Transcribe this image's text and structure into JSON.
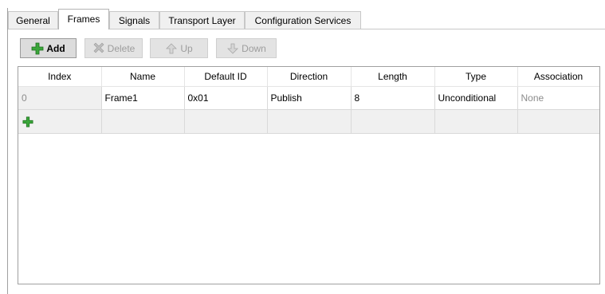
{
  "tabs": [
    {
      "label": "General"
    },
    {
      "label": "Frames",
      "active": true
    },
    {
      "label": "Signals"
    },
    {
      "label": "Transport Layer"
    },
    {
      "label": "Configuration Services"
    }
  ],
  "toolbar": {
    "add_label": "Add",
    "delete_label": "Delete",
    "up_label": "Up",
    "down_label": "Down"
  },
  "table": {
    "columns": [
      "Index",
      "Name",
      "Default ID",
      "Direction",
      "Length",
      "Type",
      "Association"
    ],
    "rows": [
      {
        "index": "0",
        "name": "Frame1",
        "default_id": "0x01",
        "direction": "Publish",
        "length": "8",
        "type": "Unconditional",
        "association": "None"
      }
    ]
  },
  "colors": {
    "add_icon": "#2e9a2e",
    "disabled_text": "#9d9d9d",
    "grid_border": "#a0a0a0"
  }
}
